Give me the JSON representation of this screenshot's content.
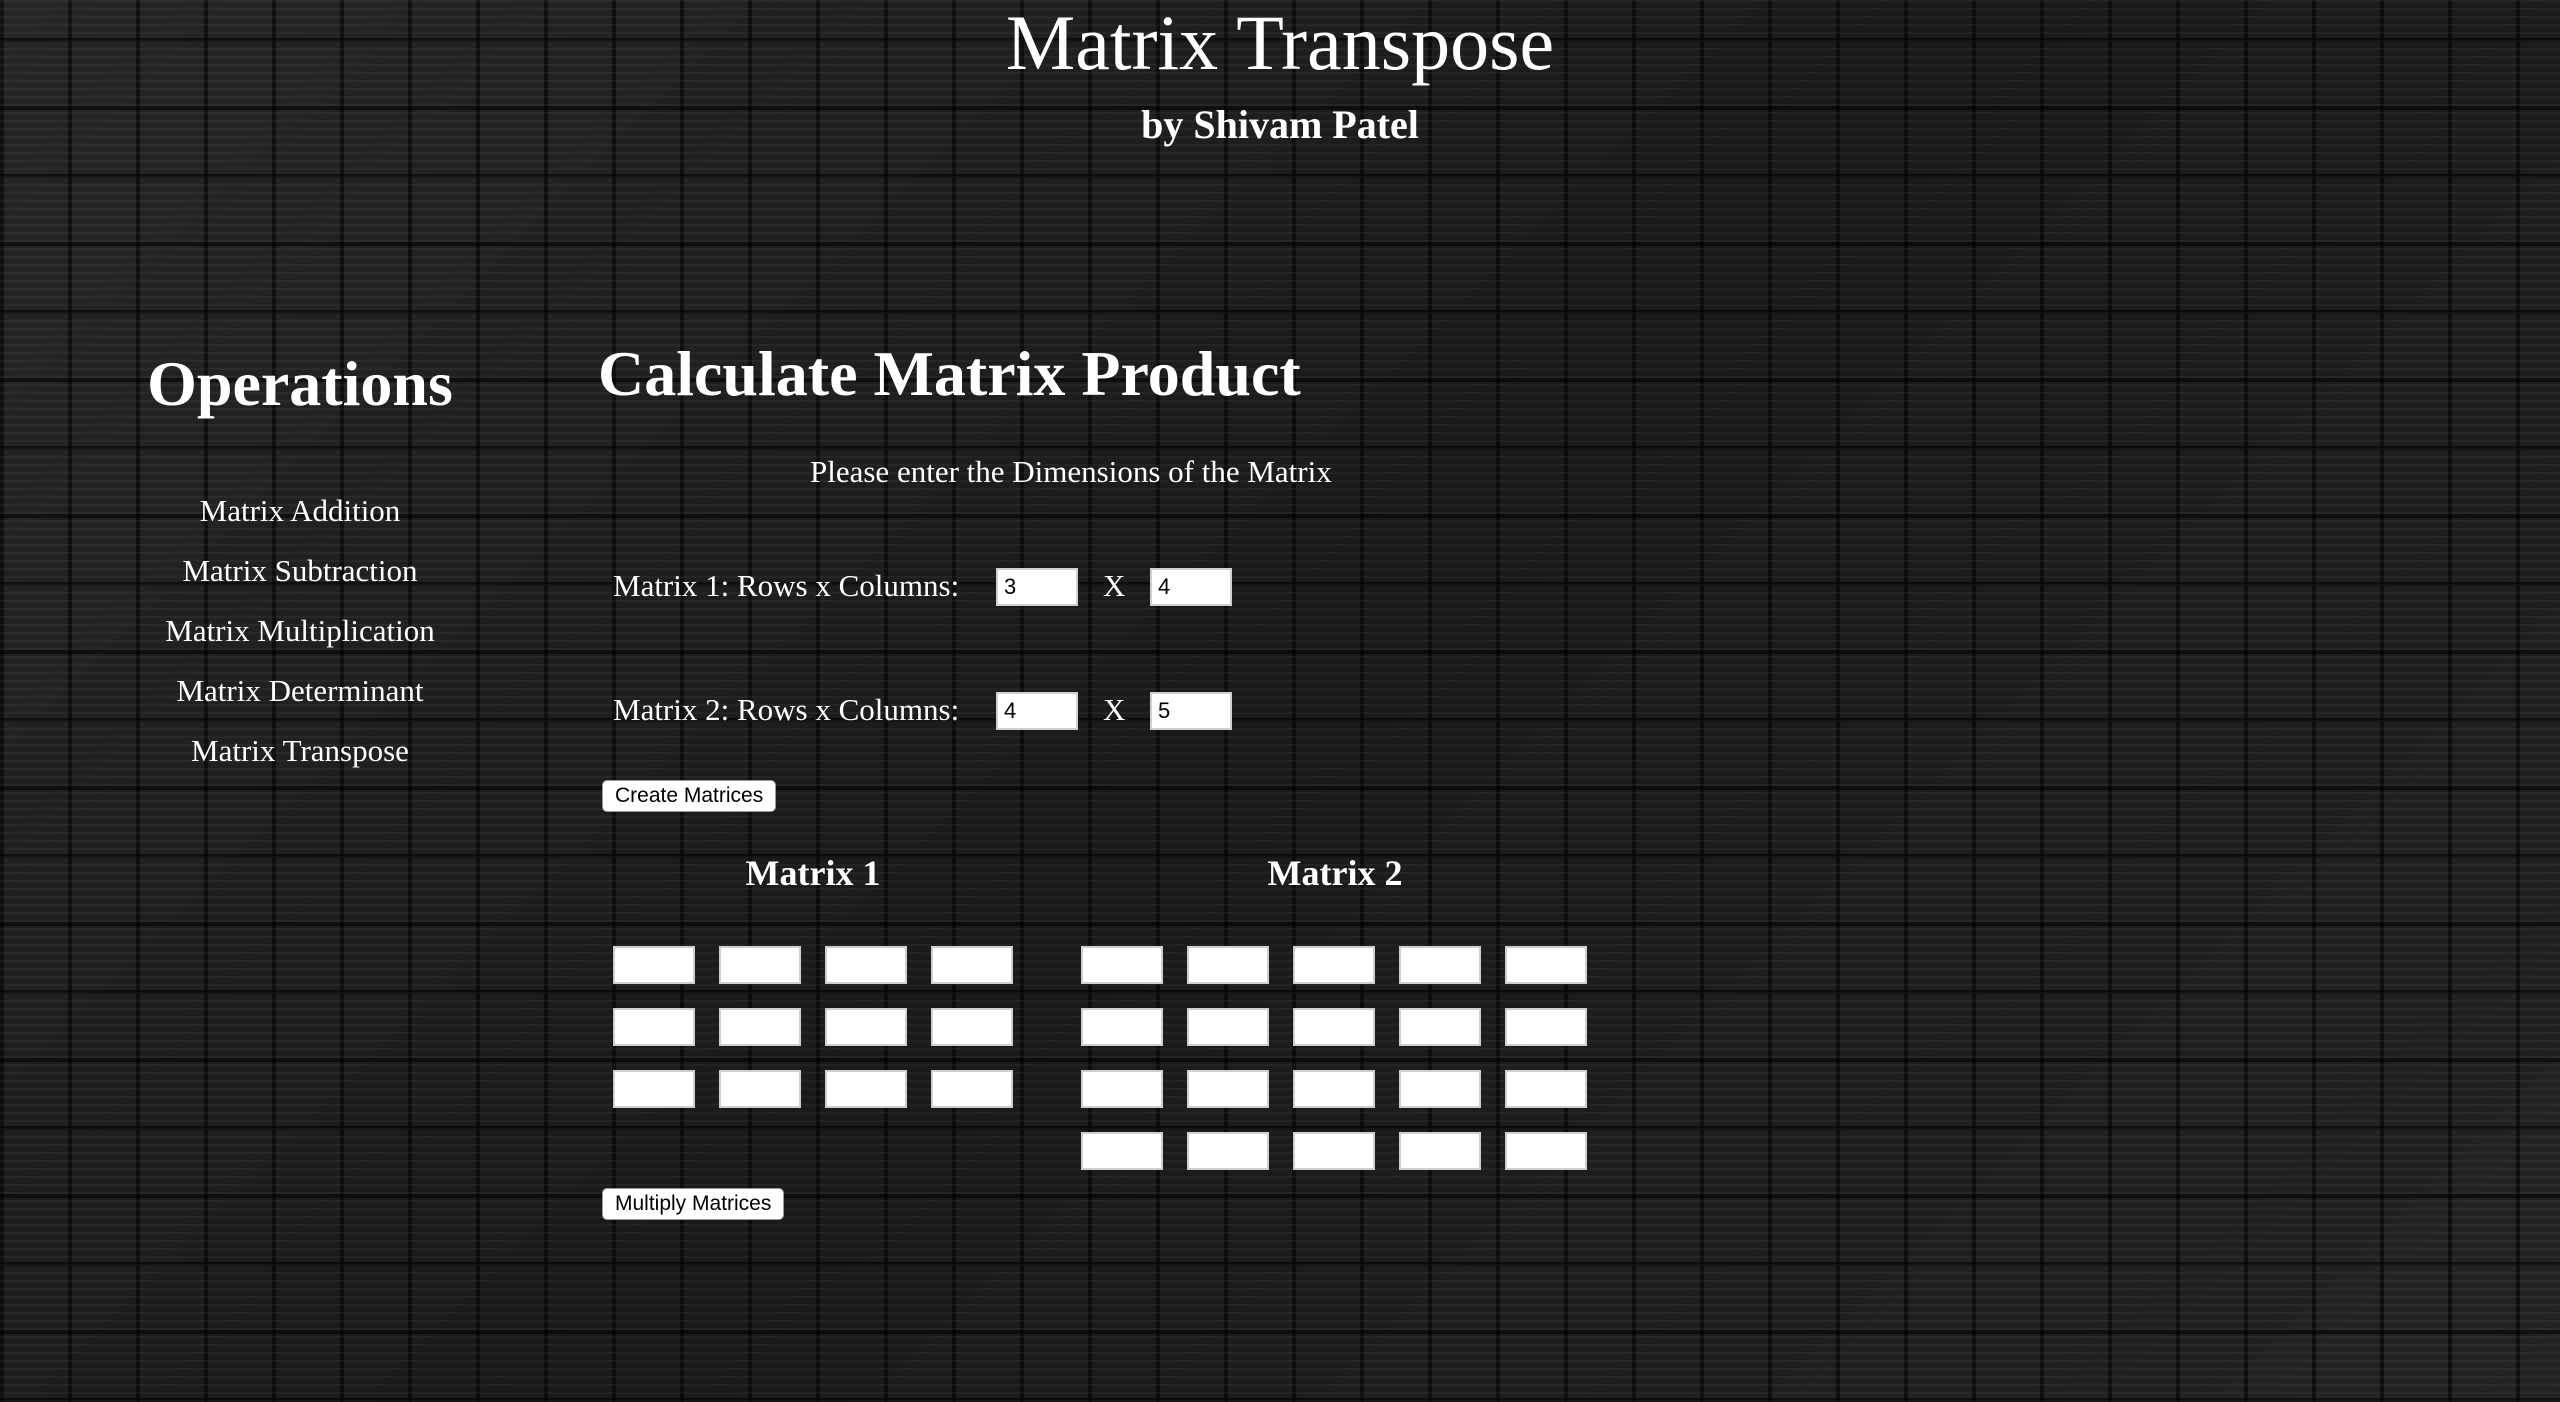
{
  "header": {
    "title": "Matrix Transpose",
    "subtitle": "by Shivam Patel"
  },
  "sidebar": {
    "heading": "Operations",
    "items": [
      {
        "label": "Matrix Addition"
      },
      {
        "label": "Matrix Subtraction"
      },
      {
        "label": "Matrix Multiplication"
      },
      {
        "label": "Matrix Determinant"
      },
      {
        "label": "Matrix Transpose"
      }
    ]
  },
  "main": {
    "heading": "Calculate Matrix Product",
    "instructions": "Please enter the Dimensions of the Matrix",
    "matrix1_dims": {
      "label": "Matrix 1: Rows x Columns:",
      "rows": "3",
      "separator": "X",
      "cols": "4"
    },
    "matrix2_dims": {
      "label": "Matrix 2: Rows x Columns:",
      "rows": "4",
      "separator": "X",
      "cols": "5"
    },
    "create_button": "Create Matrices",
    "matrix1": {
      "title": "Matrix 1",
      "rows": 3,
      "cols": 4
    },
    "matrix2": {
      "title": "Matrix 2",
      "rows": 4,
      "cols": 5
    },
    "multiply_button": "Multiply Matrices"
  }
}
